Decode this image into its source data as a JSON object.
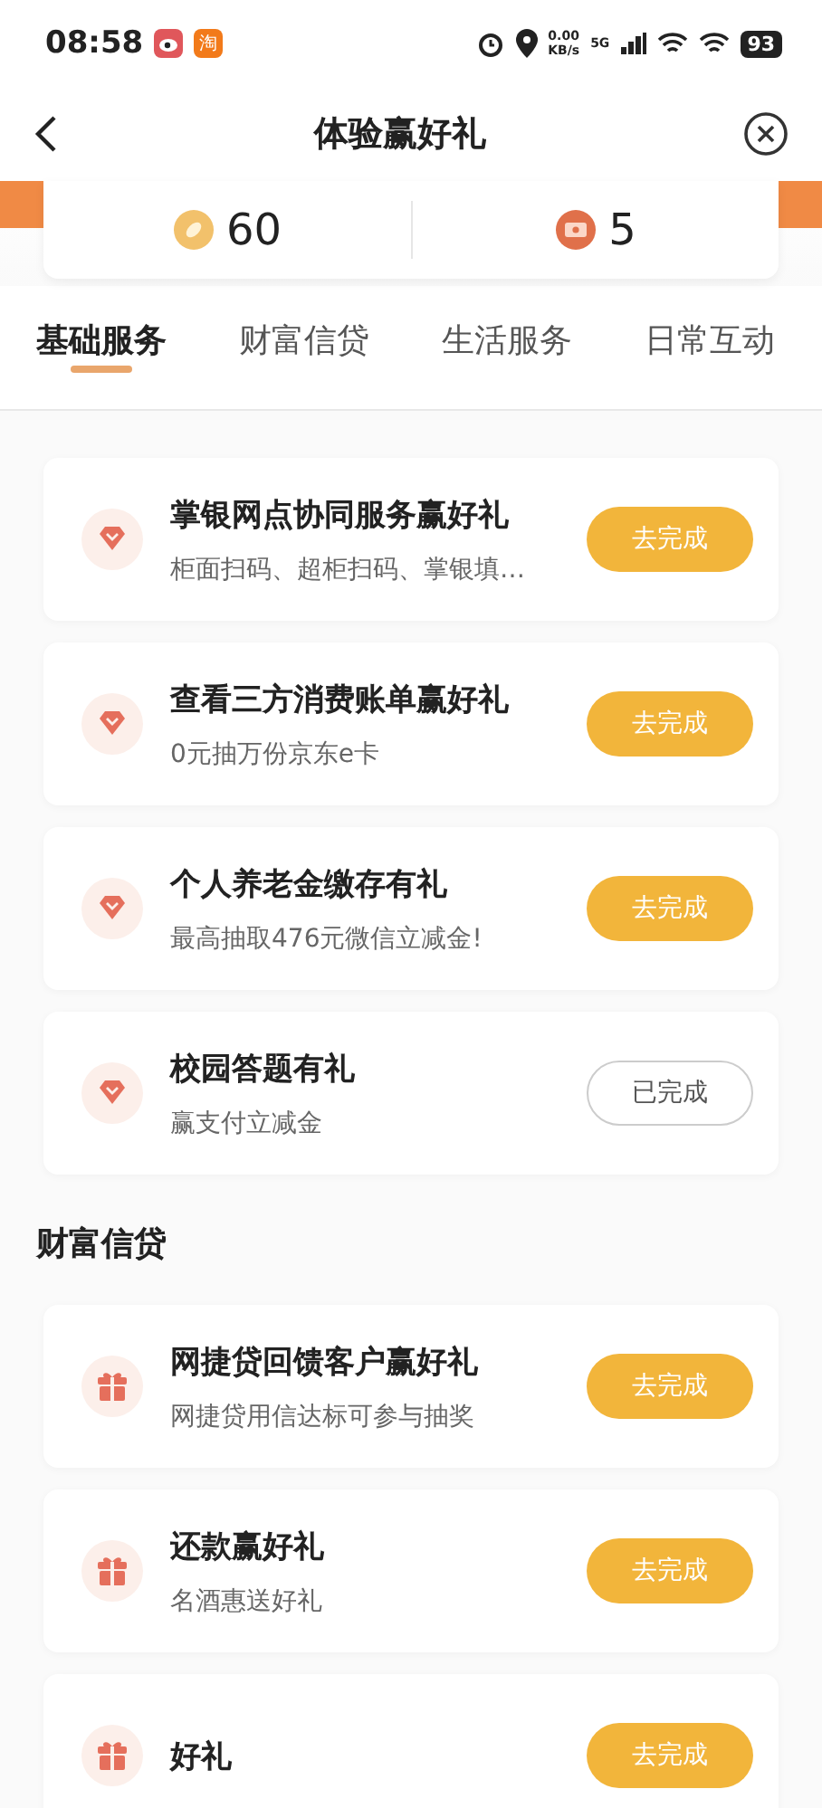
{
  "status_bar": {
    "time": "08:58",
    "app_badge": "淘",
    "network_speed": "0.00",
    "network_unit": "KB/s",
    "network_type": "5G",
    "battery": "93"
  },
  "nav": {
    "title": "体验赢好礼"
  },
  "stats": [
    {
      "kind": "coin",
      "value": "60"
    },
    {
      "kind": "ticket",
      "value": "5"
    }
  ],
  "tabs": [
    {
      "label": "基础服务",
      "selected": true
    },
    {
      "label": "财富信贷",
      "selected": false
    },
    {
      "label": "生活服务",
      "selected": false
    },
    {
      "label": "日常互动",
      "selected": false
    }
  ],
  "groups": [
    {
      "items": [
        {
          "kind": "diamond",
          "title": "掌银网点协同服务赢好礼",
          "subtitle": "柜面扫码、超柜扫码、掌银填…",
          "action": "去完成",
          "completed": false
        },
        {
          "kind": "diamond",
          "title": "查看三方消费账单赢好礼",
          "subtitle": "0元抽万份京东e卡",
          "action": "去完成",
          "completed": false
        },
        {
          "kind": "diamond",
          "title": "个人养老金缴存有礼",
          "subtitle": "最高抽取476元微信立减金!",
          "action": "去完成",
          "completed": false
        },
        {
          "kind": "diamond",
          "title": "校园答题有礼",
          "subtitle": "赢支付立减金",
          "action": "已完成",
          "completed": true
        }
      ]
    },
    {
      "heading": "财富信贷",
      "items": [
        {
          "kind": "gift",
          "title": "网捷贷回馈客户赢好礼",
          "subtitle": "网捷贷用信达标可参与抽奖",
          "action": "去完成",
          "completed": false
        },
        {
          "kind": "gift",
          "title": "还款赢好礼",
          "subtitle": "名酒惠送好礼",
          "action": "去完成",
          "completed": false
        },
        {
          "kind": "gift",
          "title": "好礼",
          "action": "去完成",
          "completed": false
        }
      ]
    }
  ]
}
